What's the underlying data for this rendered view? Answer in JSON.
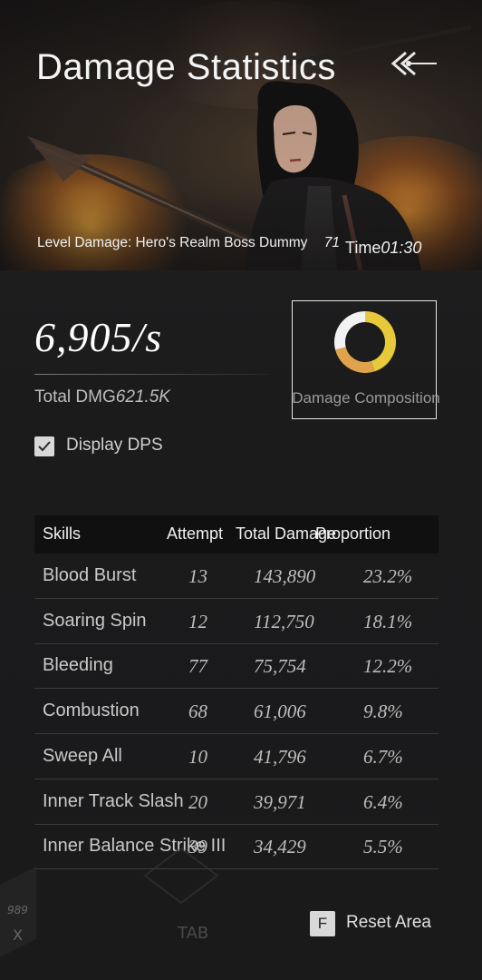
{
  "header": {
    "title": "Damage Statistics",
    "level_label": "Level Damage: Hero's Realm Boss Dummy",
    "level_number": "71",
    "time_label": "Time",
    "time_value": "01:30"
  },
  "stats": {
    "dps_value": "6,905/s",
    "total_label": "Total DMG",
    "total_value": "621.5K",
    "composition_label": "Damage Composition",
    "display_dps_label": "Display DPS",
    "display_dps_checked": true
  },
  "composition_chart": {
    "segments": [
      {
        "color": "#e8c93a",
        "fraction": 0.45
      },
      {
        "color": "#e0a24a",
        "fraction": 0.26
      },
      {
        "color": "#f2f2f2",
        "fraction": 0.29
      }
    ]
  },
  "table": {
    "headers": [
      "Skills",
      "Attempt",
      "Total Damage",
      "Proportion"
    ],
    "rows": [
      {
        "skill": "Blood Burst",
        "attempt": "13",
        "total": "143,890",
        "proportion": "23.2%"
      },
      {
        "skill": "Soaring Spin",
        "attempt": "12",
        "total": "112,750",
        "proportion": "18.1%"
      },
      {
        "skill": "Bleeding",
        "attempt": "77",
        "total": "75,754",
        "proportion": "12.2%"
      },
      {
        "skill": "Combustion",
        "attempt": "68",
        "total": "61,006",
        "proportion": "9.8%"
      },
      {
        "skill": "Sweep All",
        "attempt": "10",
        "total": "41,796",
        "proportion": "6.7%"
      },
      {
        "skill": "Inner Track Slash",
        "attempt": "20",
        "total": "39,971",
        "proportion": "6.4%"
      },
      {
        "skill": "Inner Balance Strike III",
        "attempt": "39",
        "total": "34,429",
        "proportion": "5.5%"
      }
    ]
  },
  "footer": {
    "reset_key": "F",
    "reset_label": "Reset Area",
    "bg_hint_number": "989",
    "bg_hint_key": "X",
    "bg_hint_tab": "TAB"
  },
  "icons": {
    "back": "double-chevron-left-icon",
    "check": "checkmark-icon"
  }
}
